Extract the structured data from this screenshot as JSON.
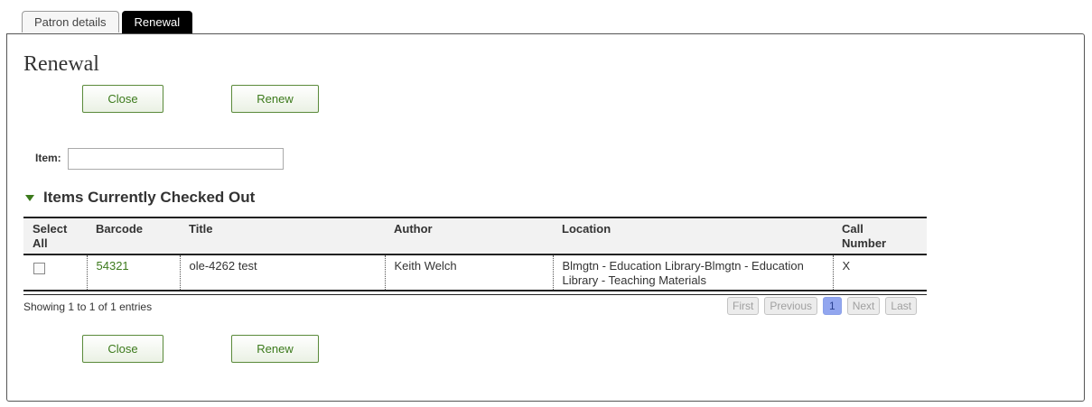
{
  "tabs": [
    {
      "label": "Patron details",
      "active": false
    },
    {
      "label": "Renewal",
      "active": true
    }
  ],
  "page_title": "Renewal",
  "buttons": {
    "close": "Close",
    "renew": "Renew"
  },
  "item_field": {
    "label": "Item:",
    "value": "",
    "placeholder": ""
  },
  "section": {
    "title": "Items Currently Checked Out",
    "icon": "triangle-down-icon"
  },
  "table": {
    "headers": {
      "select_all_1": "Select",
      "select_all_2": "All",
      "barcode": "Barcode",
      "title": "Title",
      "author": "Author",
      "location": "Location",
      "call_1": "Call",
      "call_2": "Number"
    },
    "rows": [
      {
        "checked": false,
        "barcode": "54321",
        "title": "ole-4262 test",
        "author": "Keith Welch",
        "location": "Blmgtn - Education Library-Blmgtn - Education Library - Teaching Materials",
        "call_number": "X"
      }
    ],
    "info": "Showing 1 to 1 of 1 entries"
  },
  "pagination": {
    "first": "First",
    "previous": "Previous",
    "current": "1",
    "next": "Next",
    "last": "Last"
  },
  "colors": {
    "accent_green": "#3c7a1c",
    "active_tab": "#000000",
    "current_page": "#92a6ef"
  }
}
